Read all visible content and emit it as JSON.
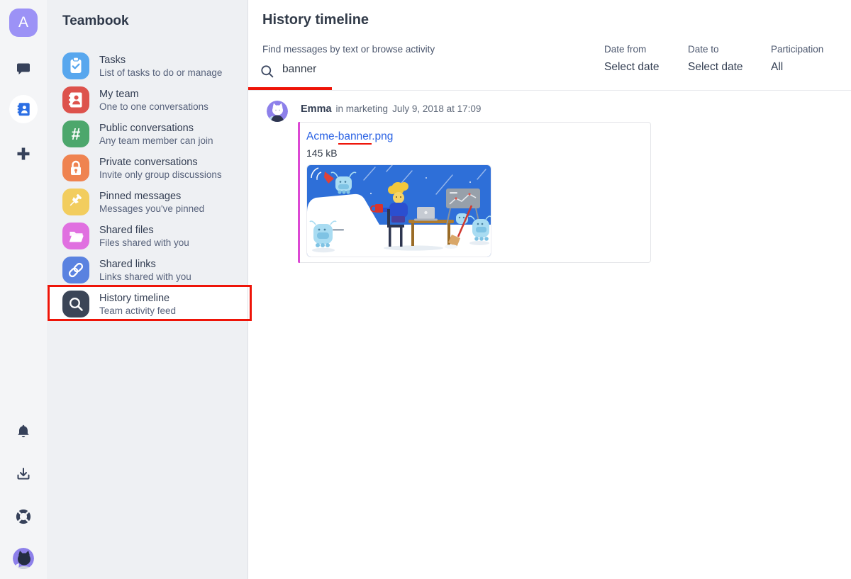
{
  "app": {
    "logo_letter": "A",
    "accent_color": "#9c92f6"
  },
  "rail": {
    "icons": [
      {
        "name": "chat"
      },
      {
        "name": "contacts",
        "active": true
      },
      {
        "name": "add"
      },
      {
        "name": "notifications"
      },
      {
        "name": "downloads"
      },
      {
        "name": "help"
      },
      {
        "name": "user-avatar"
      }
    ]
  },
  "sidebar": {
    "title": "Teambook",
    "items": [
      {
        "label": "Tasks",
        "sublabel": "List of tasks to do or manage",
        "icon": "clipboard-check",
        "color": "#58a7ee"
      },
      {
        "label": "My team",
        "sublabel": "One to one conversations",
        "icon": "address-book",
        "color": "#dd524c"
      },
      {
        "label": "Public conversations",
        "sublabel": "Any team member can join",
        "icon": "hash",
        "icon_glyph": "#",
        "color": "#4ca76c"
      },
      {
        "label": "Private conversations",
        "sublabel": "Invite only group discussions",
        "icon": "lock",
        "color": "#ef8350"
      },
      {
        "label": "Pinned messages",
        "sublabel": "Messages you've pinned",
        "icon": "pushpin",
        "color": "#f2cd5e"
      },
      {
        "label": "Shared files",
        "sublabel": "Files shared with you",
        "icon": "folder-open",
        "color": "#e070e0"
      },
      {
        "label": "Shared links",
        "sublabel": "Links shared with you",
        "icon": "chain-link",
        "color": "#5a82e0"
      },
      {
        "label": "History timeline",
        "sublabel": "Team activity feed",
        "icon": "magnifier",
        "color": "#3b4557",
        "selected": true
      }
    ]
  },
  "main": {
    "title": "History timeline",
    "search": {
      "label": "Find messages by text or browse activity",
      "value": "banner"
    },
    "filters": [
      {
        "label": "Date from",
        "value": "Select date"
      },
      {
        "label": "Date to",
        "value": "Select date"
      },
      {
        "label": "Participation",
        "value": "All"
      }
    ],
    "result": {
      "author": "Emma",
      "channel": "in marketing",
      "timestamp": "July 9, 2018 at 17:09",
      "file": {
        "name": "Acme-banner.png",
        "name_parts": [
          "Acme-",
          "banner",
          ".png"
        ],
        "size": "145 kB",
        "link_color": "#2a62e4",
        "accent_color": "#dc49d4",
        "thumbnail_alt": "banner illustration: characters working at desks on blue background"
      }
    }
  },
  "annotations": {
    "color": "#ee1408",
    "highlights": [
      "sidebar-item-history-timeline",
      "search-input",
      "filename-banner-text"
    ]
  }
}
